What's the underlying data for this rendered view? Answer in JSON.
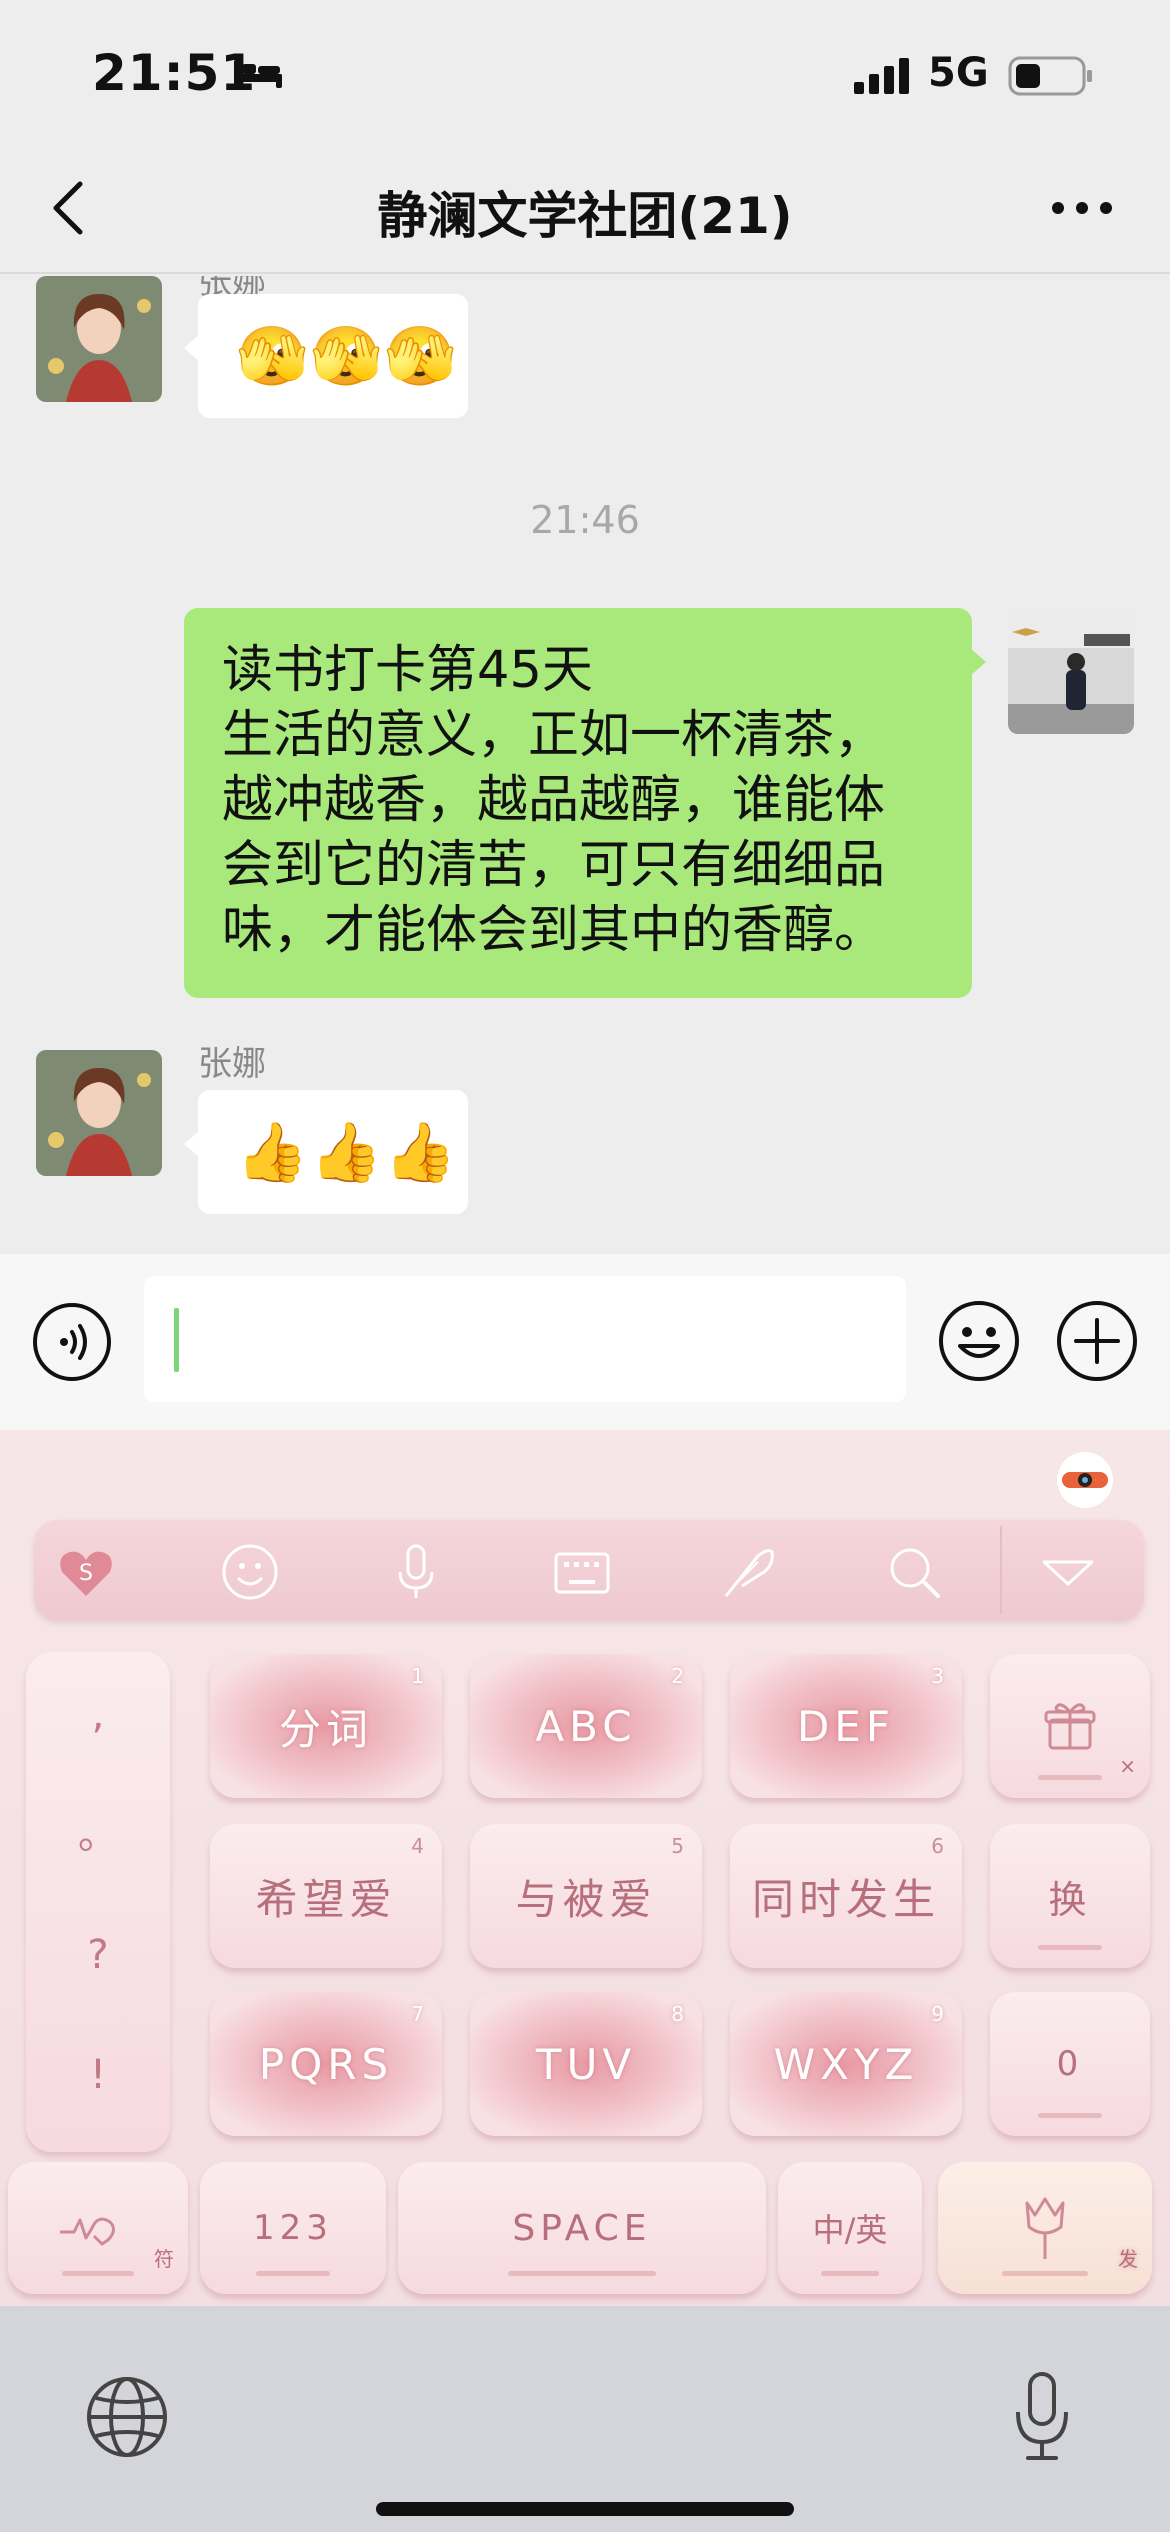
{
  "status_bar": {
    "time": "21:51",
    "network": "5G"
  },
  "header": {
    "title": "静澜文学社团(21)"
  },
  "messages": {
    "first": {
      "sender_partial": "张娜",
      "emoji": "🫣🫣🫣"
    },
    "timestamp": "21:46",
    "own": {
      "text": "读书打卡第45天\n生活的意义，正如一杯清茶，\n越冲越香，越品越醇，谁能体\n会到它的清苦，可只有细细品\n味，才能体会到其中的香醇。"
    },
    "last": {
      "sender": "张娜",
      "emoji": "👍👍👍"
    }
  },
  "input": {
    "value": ""
  },
  "keyboard": {
    "punct": [
      ",",
      "。",
      "?",
      "!"
    ],
    "rows": [
      [
        {
          "label": "分词",
          "num": "1"
        },
        {
          "label": "ABC",
          "num": "2"
        },
        {
          "label": "DEF",
          "num": "3"
        }
      ],
      [
        {
          "label": "希望爱",
          "num": "4"
        },
        {
          "label": "与被爱",
          "num": "5"
        },
        {
          "label": "同时发生",
          "num": "6"
        }
      ],
      [
        {
          "label": "PQRS",
          "num": "7"
        },
        {
          "label": "TUV",
          "num": "8"
        },
        {
          "label": "WXYZ",
          "num": "9"
        }
      ]
    ],
    "right_col": {
      "clear_sub": "×",
      "switch": "换",
      "zero": "0"
    },
    "bottom": {
      "symbols_sub": "符",
      "num": "123",
      "space": "SPACE",
      "lang": "中/英",
      "send_sub": "发"
    }
  },
  "colors": {
    "bubble_green": "#a9e97b",
    "keyboard_pink": "#f3dee1"
  }
}
